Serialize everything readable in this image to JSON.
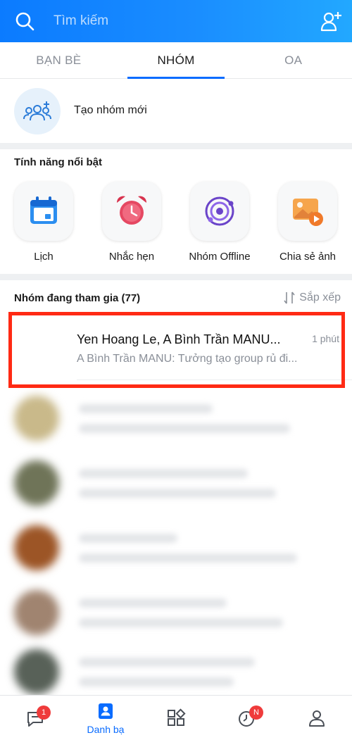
{
  "header": {
    "search_placeholder": "Tìm kiếm",
    "search_icon": "search-icon",
    "add_icon": "add-friend-icon",
    "background": "#1a8dff"
  },
  "tabs": [
    {
      "label": "BẠN BÈ",
      "active": false
    },
    {
      "label": "NHÓM",
      "active": true
    },
    {
      "label": "OA",
      "active": false
    }
  ],
  "create_group": {
    "label": "Tạo nhóm mới",
    "icon": "add-group-icon"
  },
  "features": {
    "title": "Tính năng nổi bật",
    "items": [
      {
        "label": "Lịch",
        "icon": "calendar-icon"
      },
      {
        "label": "Nhắc hẹn",
        "icon": "alarm-clock-icon"
      },
      {
        "label": "Nhóm Offline",
        "icon": "orbit-icon"
      },
      {
        "label": "Chia sẻ ảnh",
        "icon": "photo-share-icon"
      }
    ]
  },
  "groups": {
    "title": "Nhóm đang tham gia (77)",
    "sort_label": "Sắp xếp",
    "sort_icon": "sort-icon",
    "rows": [
      {
        "name": "Yen Hoang Le, A Bình Trần MANU...",
        "message": "A Bình Trần MANU: Tưởng tạo group rủ đi...",
        "time": "1 phút"
      }
    ]
  },
  "bottom_nav": [
    {
      "icon": "chat-icon",
      "label": "",
      "badge": "1"
    },
    {
      "icon": "contacts-icon",
      "label": "Danh bạ",
      "badge": ""
    },
    {
      "icon": "apps-grid-icon",
      "label": "",
      "badge": ""
    },
    {
      "icon": "clock-icon",
      "label": "",
      "badge": "N"
    },
    {
      "icon": "profile-icon",
      "label": "",
      "badge": ""
    }
  ],
  "colors": {
    "accent": "#0a6cff",
    "highlight": "#ff2a14",
    "badge": "#ef3b3b"
  }
}
